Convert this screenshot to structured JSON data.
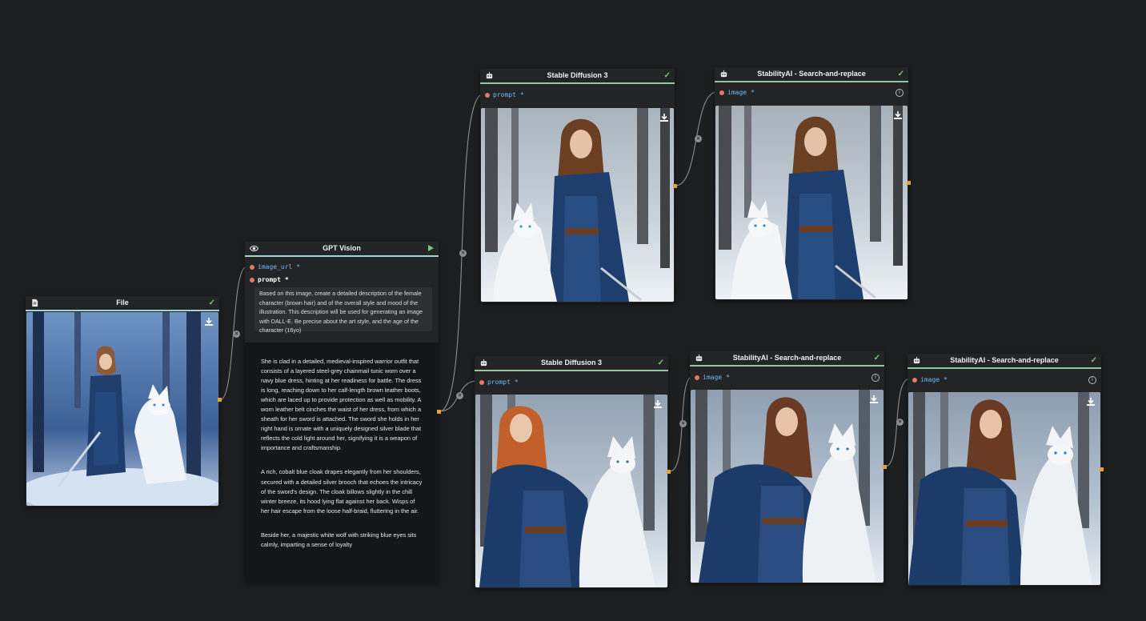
{
  "colors": {
    "canvas": "#1c1e1f",
    "node_bg": "#222426",
    "accent_port": "#e4a232",
    "required_dot": "#e07a6a",
    "input_label": "#6fb8ff",
    "success_check": "#78c878"
  },
  "nodes": {
    "file": {
      "title": "File",
      "icon": "document-icon",
      "status": "✓"
    },
    "gpt_vision": {
      "title": "GPT Vision",
      "icon": "eye-icon",
      "inputs": [
        {
          "name": "image_url",
          "required": "*"
        },
        {
          "name": "prompt",
          "required": "*"
        }
      ],
      "prompt_text": "Based on this image, create a detailed description of the female character (brown hair) and of the overall style and mood of the illustration. This description will be used for generating an image with DALL-E. Be precise about the art style, and the age of the character (16yo)",
      "output_paragraphs": [
        "She is clad in a detailed, medieval-inspired warrior outfit that consists of a layered steel-grey chainmail tunic worn over a navy blue dress, hinting at her readiness for battle. The dress is long, reaching down to her calf-length brown leather boots, which are laced up to provide protection as well as mobility. A worn leather belt cinches the waist of her dress, from which a sheath for her sword is attached. The sword she holds in her right hand is ornate with a uniquely designed silver blade that reflects the cold light around her, signifying it is a weapon of importance and craftsmanship.",
        "A rich, cobalt blue cloak drapes elegantly from her shoulders, secured with a detailed silver brooch that echoes the intricacy of the sword's design. The cloak billows slightly in the chill winter breeze, its hood lying flat against her back. Wisps of her hair escape from the loose half-braid, fluttering in the air.",
        "Beside her, a majestic white wolf with striking blue eyes sits calmly, imparting a sense of loyalty"
      ]
    },
    "sd3_top": {
      "title": "Stable Diffusion 3",
      "icon": "robot-icon",
      "status": "✓",
      "input": {
        "name": "prompt",
        "required": "*"
      }
    },
    "sr_top": {
      "title": "StabilityAI - Search-and-replace",
      "icon": "robot-icon",
      "status": "✓",
      "input": {
        "name": "image",
        "required": "*"
      }
    },
    "sd3_bottom": {
      "title": "Stable Diffusion 3",
      "icon": "robot-icon",
      "status": "✓",
      "input": {
        "name": "prompt",
        "required": "*"
      }
    },
    "sr_bottom_1": {
      "title": "StabilityAI - Search-and-replace",
      "icon": "robot-icon",
      "status": "✓",
      "input": {
        "name": "image",
        "required": "*"
      }
    },
    "sr_bottom_2": {
      "title": "StabilityAI - Search-and-replace",
      "icon": "robot-icon",
      "status": "✓",
      "input": {
        "name": "image",
        "required": "*"
      }
    }
  },
  "connector_glyph": "×",
  "info_glyph": "i"
}
